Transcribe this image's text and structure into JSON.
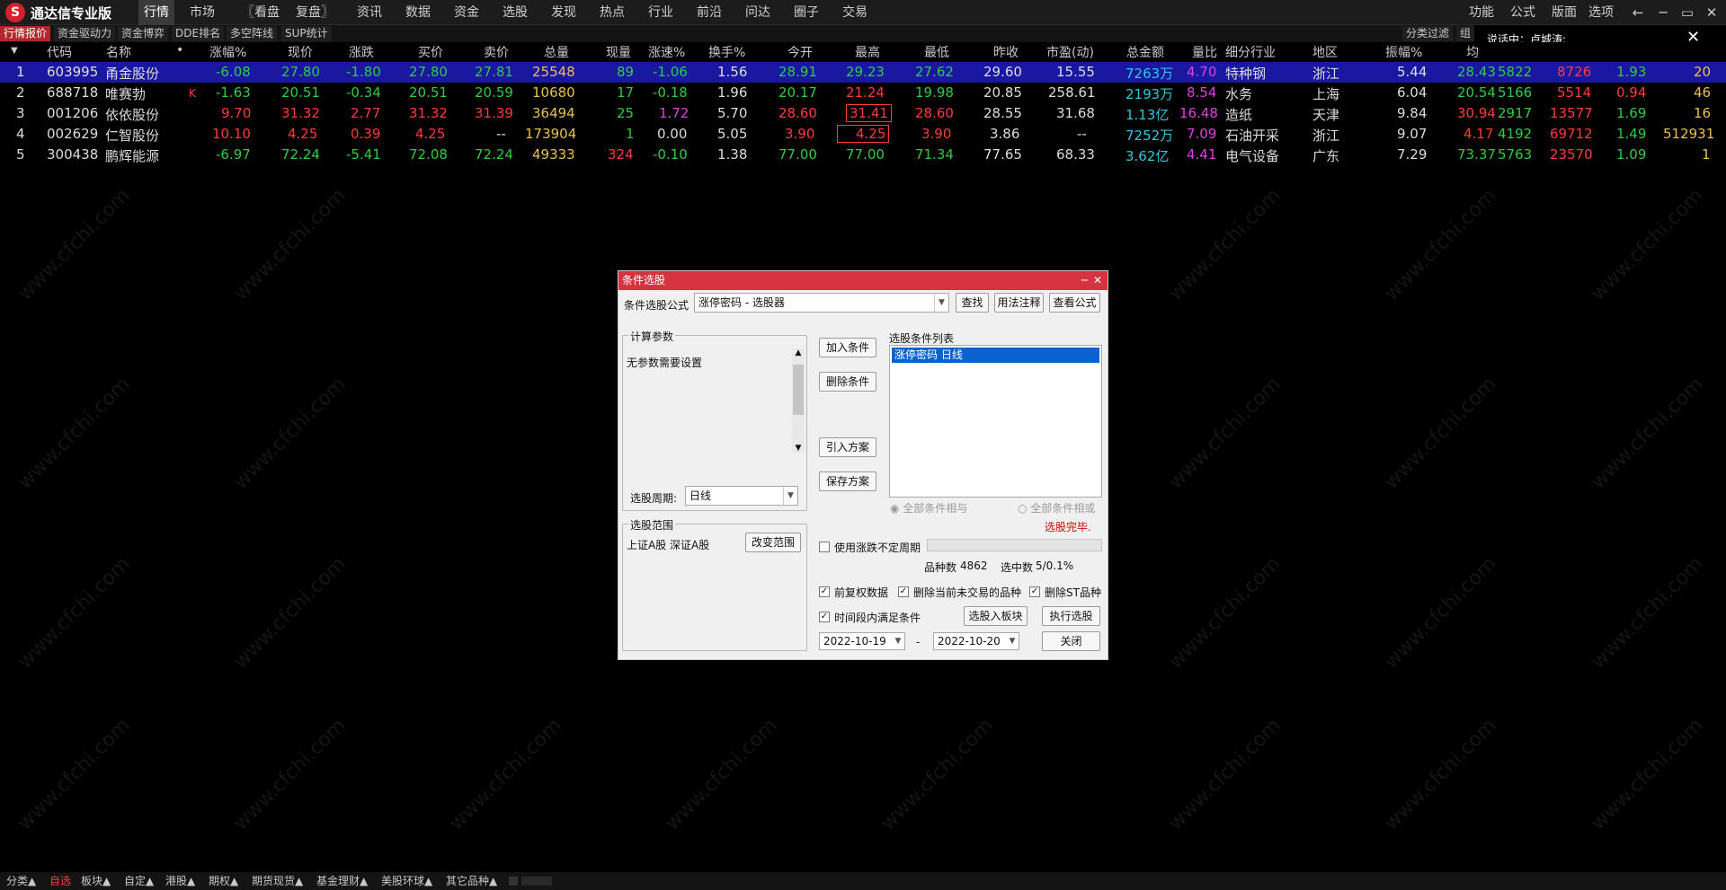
{
  "app": {
    "title": "通达信专业版",
    "logo_glyph": "S",
    "logo_color": "#d8202a"
  },
  "menu": [
    "行情",
    "市场",
    "〖看盘",
    "复盘〗",
    "资讯",
    "数据",
    "资金",
    "选股",
    "发现",
    "热点",
    "行业",
    "前沿",
    "问达",
    "圈子",
    "交易"
  ],
  "menu_right": [
    "功能",
    "公式",
    "版面",
    "选项"
  ],
  "window_controls": [
    "←",
    "─",
    "▭",
    "✕"
  ],
  "subtabs": [
    "行情报价",
    "资金驱动力",
    "资金博弈",
    "DDE排名",
    "多空阵线",
    "SUP统计"
  ],
  "subtabs_right": [
    "分类过滤",
    "组"
  ],
  "chat": {
    "text": "说话中：卢城涛;",
    "close": "✕"
  },
  "table": {
    "headers": [
      "代码",
      "名称",
      "•",
      "涨幅%",
      "现价",
      "涨跌",
      "买价",
      "卖价",
      "总量",
      "现量",
      "涨速%",
      "换手%",
      "今开",
      "最高",
      "最低",
      "昨收",
      "市盈(动)",
      "总金额",
      "量比",
      "细分行业",
      "地区",
      "振幅%",
      "均"
    ],
    "rows": [
      {
        "idx": "1",
        "code": "603995",
        "name": "甬金股份",
        "flag": "",
        "pct": "-6.08",
        "price": "27.80",
        "chg": "-1.80",
        "bid": "27.80",
        "ask": "27.81",
        "vol": "25548",
        "cur": "89",
        "speed": "-1.06",
        "turn": "1.56",
        "open": "28.91",
        "high": "29.23",
        "low": "27.62",
        "prev": "29.60",
        "pe": "15.55",
        "amt": "7263万",
        "lb": "4.70",
        "ind": "特种钢",
        "area": "浙江",
        "amp": "5.44",
        "avg": "28.43",
        "x1": "5822",
        "x2": "8726",
        "x3": "1.93",
        "x4": "20"
      },
      {
        "idx": "2",
        "code": "688718",
        "name": "唯赛勃",
        "flag": "K",
        "pct": "-1.63",
        "price": "20.51",
        "chg": "-0.34",
        "bid": "20.51",
        "ask": "20.59",
        "vol": "10680",
        "cur": "17",
        "speed": "-0.18",
        "turn": "1.96",
        "open": "20.17",
        "high": "21.24",
        "low": "19.98",
        "prev": "20.85",
        "pe": "258.61",
        "amt": "2193万",
        "lb": "8.54",
        "ind": "水务",
        "area": "上海",
        "amp": "6.04",
        "avg": "20.54",
        "x1": "5166",
        "x2": "5514",
        "x3": "0.94",
        "x4": "46"
      },
      {
        "idx": "3",
        "code": "001206",
        "name": "依依股份",
        "flag": "",
        "pct": "9.70",
        "price": "31.32",
        "chg": "2.77",
        "bid": "31.32",
        "ask": "31.39",
        "vol": "36494",
        "cur": "25",
        "speed": "1.72",
        "turn": "5.70",
        "open": "28.60",
        "high": "31.41",
        "low": "28.60",
        "prev": "28.55",
        "pe": "31.68",
        "amt": "1.13亿",
        "lb": "16.48",
        "ind": "造纸",
        "area": "天津",
        "amp": "9.84",
        "avg": "30.94",
        "x1": "2917",
        "x2": "13577",
        "x3": "1.69",
        "x4": "16"
      },
      {
        "idx": "4",
        "code": "002629",
        "name": "仁智股份",
        "flag": "",
        "pct": "10.10",
        "price": "4.25",
        "chg": "0.39",
        "bid": "4.25",
        "ask": "--",
        "vol": "173904",
        "cur": "1",
        "speed": "0.00",
        "turn": "5.05",
        "open": "3.90",
        "high": "4.25",
        "low": "3.90",
        "prev": "3.86",
        "pe": "--",
        "amt": "7252万",
        "lb": "7.09",
        "ind": "石油开采",
        "area": "浙江",
        "amp": "9.07",
        "avg": "4.17",
        "x1": "4192",
        "x2": "69712",
        "x3": "1.49",
        "x4": "512931"
      },
      {
        "idx": "5",
        "code": "300438",
        "name": "鹏辉能源",
        "flag": "",
        "pct": "-6.97",
        "price": "72.24",
        "chg": "-5.41",
        "bid": "72.08",
        "ask": "72.24",
        "vol": "49333",
        "cur": "324",
        "speed": "-0.10",
        "turn": "1.38",
        "open": "77.00",
        "high": "77.00",
        "low": "71.34",
        "prev": "77.65",
        "pe": "68.33",
        "amt": "3.62亿",
        "lb": "4.41",
        "ind": "电气设备",
        "area": "广东",
        "amp": "7.29",
        "avg": "73.37",
        "x1": "5763",
        "x2": "23570",
        "x3": "1.09",
        "x4": "1"
      }
    ]
  },
  "dialog": {
    "title": "条件选股",
    "formula_label": "条件选股公式",
    "formula_value": "涨停密码   - 选股器",
    "btn_find": "查找",
    "btn_usage": "用法注释",
    "btn_view": "查看公式",
    "params_group": "计算参数",
    "params_text": "无参数需要设置",
    "period_label": "选股周期:",
    "period_value": "日线",
    "btn_add": "加入条件",
    "btn_delete": "删除条件",
    "btn_import": "引入方案",
    "btn_save": "保存方案",
    "list_label": "选股条件列表",
    "list_items": [
      "涨停密码  日线"
    ],
    "radio_and": "全部条件相与",
    "radio_or": "全部条件相或",
    "status": "选股完毕.",
    "scope_group": "选股范围",
    "scope_text": "上证A股 深证A股",
    "btn_scope": "改变范围",
    "chk_period": "使用涨跌不定周期",
    "count_label": "品种数",
    "count_value": "4862",
    "selected_label": "选中数",
    "selected_value": "5/0.1%",
    "chk_adjust": "前复权数据",
    "chk_untraded": "删除当前未交易的品种",
    "chk_st": "删除ST品种",
    "chk_time": "时间段内满足条件",
    "btn_to_block": "选股入板块",
    "btn_execute": "执行选股",
    "date_from": "2022-10-19",
    "date_sep": "-",
    "date_to": "2022-10-20",
    "btn_close": "关闭"
  },
  "bottom_tabs": [
    "分类▲",
    "自选",
    "板块▲",
    "自定▲",
    "港股▲",
    "期权▲",
    "期货现货▲",
    "基金理财▲",
    "美股环球▲",
    "其它品种▲"
  ],
  "watermark": "www.cfchi.com"
}
